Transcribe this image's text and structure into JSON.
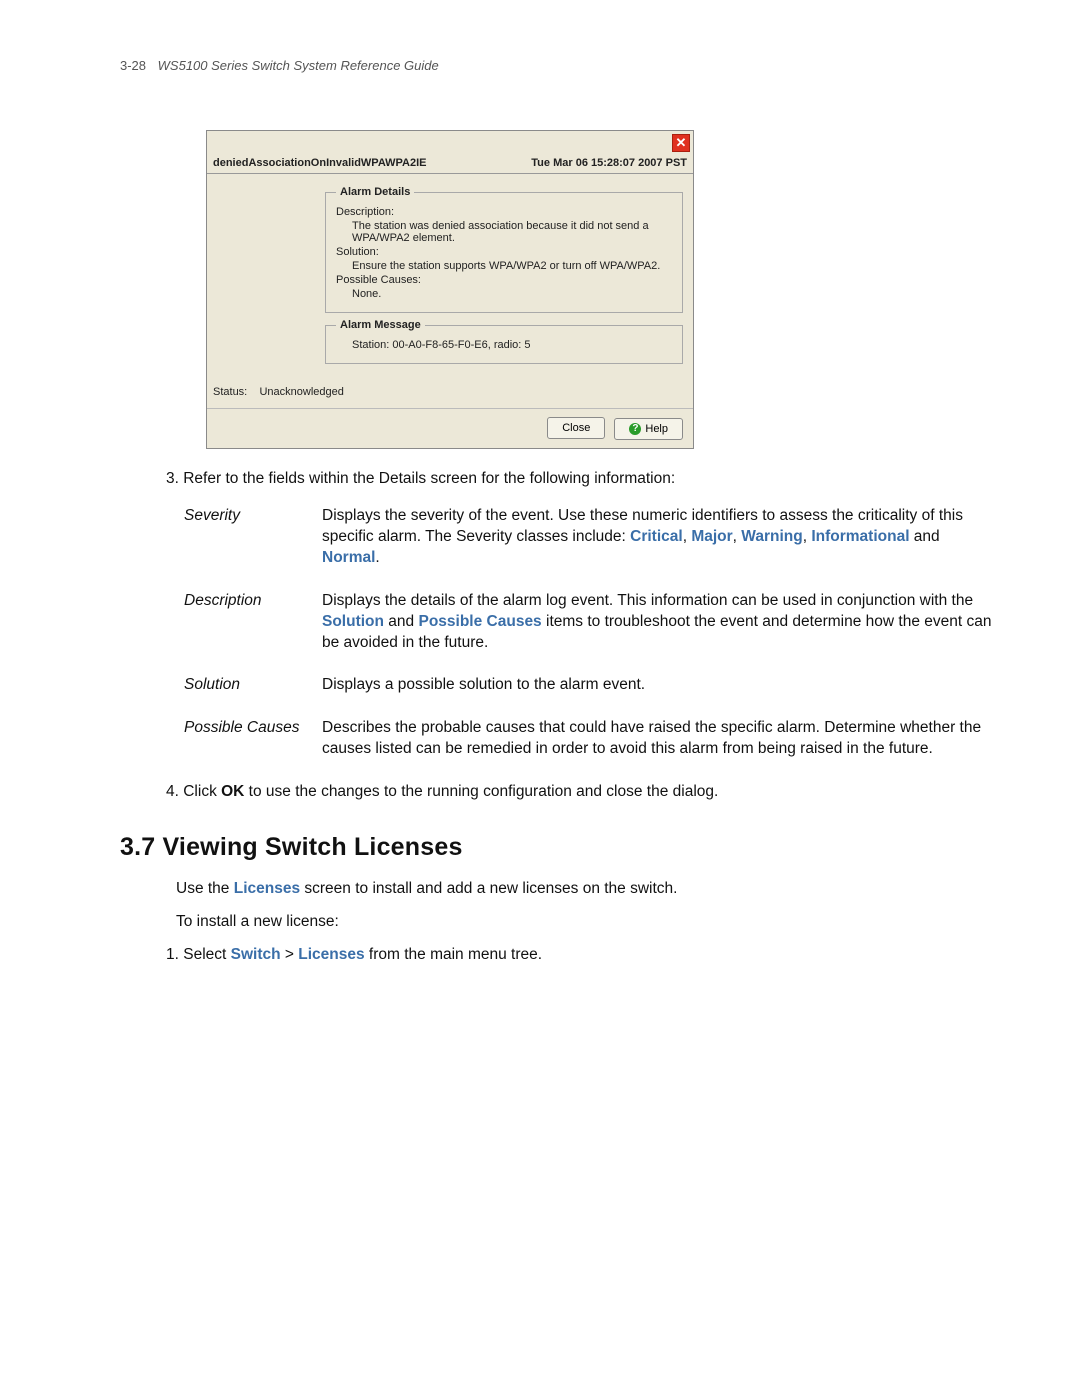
{
  "header": {
    "page_num": "3-28",
    "title": "WS5100 Series Switch System Reference Guide"
  },
  "dialog": {
    "title_left": "deniedAssociationOnInvalidWPAWPA2IE",
    "title_right": "Tue Mar 06 15:28:07 2007 PST",
    "alarm_details": {
      "legend": "Alarm Details",
      "description_label": "Description:",
      "description_text": "The station was denied association because it did not send a WPA/WPA2 element.",
      "solution_label": "Solution:",
      "solution_text": "Ensure the station supports WPA/WPA2 or turn off WPA/WPA2.",
      "causes_label": "Possible Causes:",
      "causes_text": "None."
    },
    "alarm_message": {
      "legend": "Alarm Message",
      "text": "Station: 00-A0-F8-65-F0-E6, radio: 5"
    },
    "status_label": "Status:",
    "status_value": "Unacknowledged",
    "close_label": "Close",
    "help_label": "Help"
  },
  "step3": "3. Refer to the fields within the Details screen for the following information:",
  "defs": {
    "severity": {
      "term": "Severity",
      "pre": "Displays the severity of the event. Use these numeric identifiers to assess the criticality of this specific alarm. The Severity classes include: ",
      "k1": "Critical",
      "s1": ", ",
      "k2": "Major",
      "s2": ", ",
      "k3": "Warning",
      "s3": ", ",
      "k4": "Informational",
      "mid": " and ",
      "k5": "Normal",
      "end": "."
    },
    "description": {
      "term": "Description",
      "pre": "Displays the details of the alarm log event. This information can be used in conjunction with the ",
      "k1": "Solution",
      "mid1": " and ",
      "k2": "Possible Causes",
      "post": " items to troubleshoot the event and determine how the event can be avoided in the future."
    },
    "solution": {
      "term": "Solution",
      "text": "Displays a possible solution to the alarm event."
    },
    "causes": {
      "term": "Possible Causes",
      "text": "Describes the probable causes that could have raised the specific alarm. Determine whether the causes listed can be remedied in order to avoid this alarm from being raised in the future."
    }
  },
  "step4": {
    "pre": "4. Click ",
    "ok": "OK",
    "post": " to use the changes to the running configuration and close the dialog."
  },
  "section": {
    "heading": "3.7 Viewing Switch Licenses",
    "p1_pre": "Use the ",
    "p1_kw": "Licenses",
    "p1_post": " screen to install and add a new licenses on the switch.",
    "p2": "To install a new license:",
    "s1_pre": "1. Select ",
    "s1_k1": "Switch",
    "s1_gt": " > ",
    "s1_k2": "Licenses",
    "s1_post": " from the main menu tree."
  }
}
